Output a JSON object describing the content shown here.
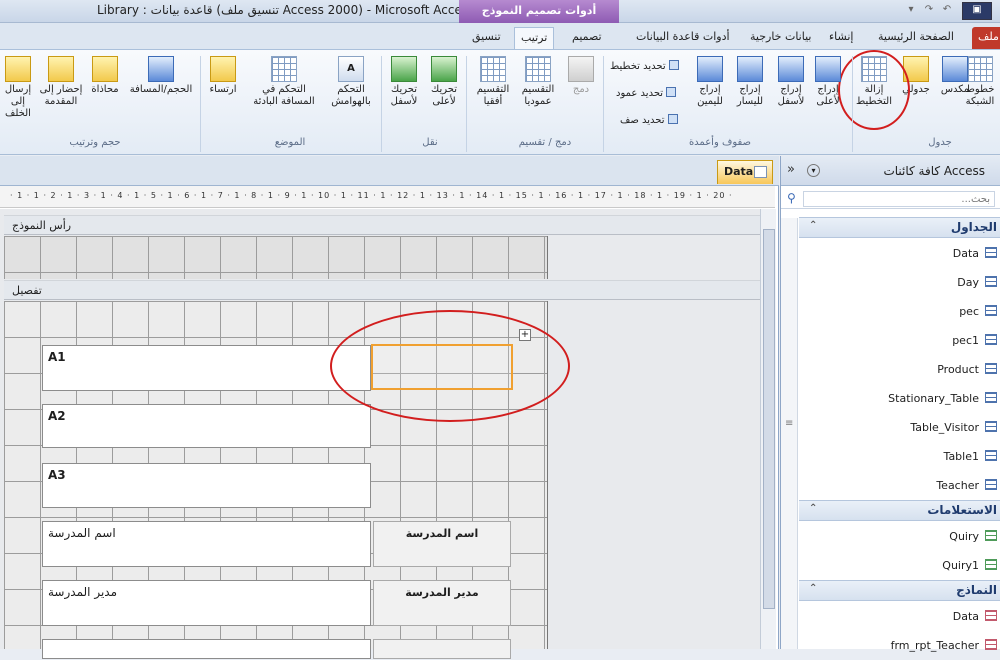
{
  "window": {
    "title": "Library : قاعدة بيانات (تنسيق ملف Access 2000) - Microsoft Access",
    "context_tab_group": "أدوات تصميم النموذج"
  },
  "tabs": {
    "file": "ملف",
    "home": "الصفحة الرئيسية",
    "create": "إنشاء",
    "external_data": "بيانات خارجية",
    "database_tools": "أدوات قاعدة البيانات",
    "design": "تصميم",
    "arrange": "ترتيب",
    "format": "تنسيق"
  },
  "ribbon": {
    "table_group": {
      "label": "جدول",
      "gridlines": "خطوط الشبكة",
      "stacked": "مكدس",
      "tabular": "جدولي",
      "remove_layout": "إزالة التخطيط"
    },
    "rows_columns_group": {
      "label": "صفوف وأعمدة",
      "insert_above": "إدراج لأعلى",
      "insert_below": "إدراج لأسفل",
      "insert_left": "إدراج لليسار",
      "insert_right": "إدراج لليمين",
      "select_layout": "تحديد تخطيط",
      "select_column": "تحديد عمود",
      "select_row": "تحديد صف"
    },
    "merge_split_group": {
      "label": "دمج / تقسيم",
      "merge": "دمج",
      "split_vertical": "التقسيم عموديا",
      "split_horizontal": "التقسيم أفقيا"
    },
    "move_group": {
      "label": "نقل",
      "move_up": "تحريك لأعلى",
      "move_down": "تحريك لأسفل"
    },
    "position_group": {
      "label": "الموضع",
      "control_margins": "التحكم بالهوامش",
      "control_padding": "التحكم في المسافة البادئة",
      "anchoring": "ارتساء"
    },
    "sizing_group": {
      "label": "حجم وترتيب",
      "size_space": "الحجم/المسافة",
      "align": "محاذاة",
      "bring_to_front": "إحضار إلى المقدمة",
      "send_to_back": "إرسال إلى الخلف"
    }
  },
  "document": {
    "tab_label": "Data",
    "ruler": "· 1 · 1 · 2 · 1 · 3 · 1 · 4 · 1 · 5 · 1 · 6 · 1 · 7 · 1 · 8 · 1 · 9 · 1 · 10 · 1 · 11 · 1 · 12 · 1 · 13 · 1 · 14 · 1 · 15 · 1 · 16 · 1 · 17 · 1 · 18 · 1 · 19 · 1 · 20 ·",
    "form_header": "رأس النموذج",
    "detail": "تفصيل",
    "fields": [
      "A1",
      "A2",
      "A3"
    ],
    "school_name_value": "اسم المدرسة",
    "school_name_label": "اسم المدرسة",
    "principal_value": "مدير المدرسة",
    "principal_label": "مدير المدرسة"
  },
  "nav_pane": {
    "title": "كافة كائنات Access",
    "search_placeholder": "...بحث",
    "categories": [
      {
        "name": "الجداول",
        "items": [
          "Data",
          "Day",
          "pec",
          "pec1",
          "Product",
          "Stationary_Table",
          "Table_Visitor",
          "Table1",
          "Teacher"
        ]
      },
      {
        "name": "الاستعلامات",
        "items": [
          "Quiry",
          "Quiry1"
        ]
      },
      {
        "name": "النماذج",
        "items": [
          "Data",
          "frm_rpt_Teacher"
        ]
      }
    ]
  },
  "colors": {
    "annotation_red": "#d21e1e",
    "selection_orange": "#f0a030",
    "context_purple": "#8e5bb3"
  }
}
